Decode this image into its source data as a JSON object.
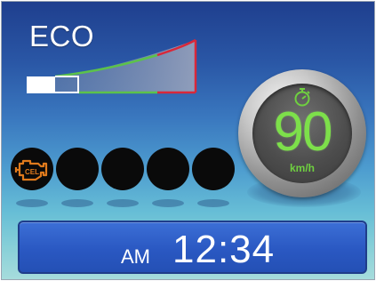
{
  "eco": {
    "label": "ECO",
    "fill_level": 0.18
  },
  "speedometer": {
    "value": "90",
    "unit": "km/h",
    "icon": "stopwatch-icon",
    "value_color": "#7de04a"
  },
  "warning_lamps": [
    {
      "name": "check-engine-light",
      "icon": "check-engine-icon",
      "label": "CEL",
      "active": true,
      "color": "#e07a1c"
    },
    {
      "name": "warning-lamp-2",
      "active": false
    },
    {
      "name": "warning-lamp-3",
      "active": false
    },
    {
      "name": "warning-lamp-4",
      "active": false
    },
    {
      "name": "warning-lamp-5",
      "active": false
    }
  ],
  "clock": {
    "ampm": "AM",
    "time": "12:34"
  },
  "colors": {
    "eco_green": "#5cc24a",
    "eco_red": "#d8283a",
    "clock_panel": "#2a58c2"
  }
}
